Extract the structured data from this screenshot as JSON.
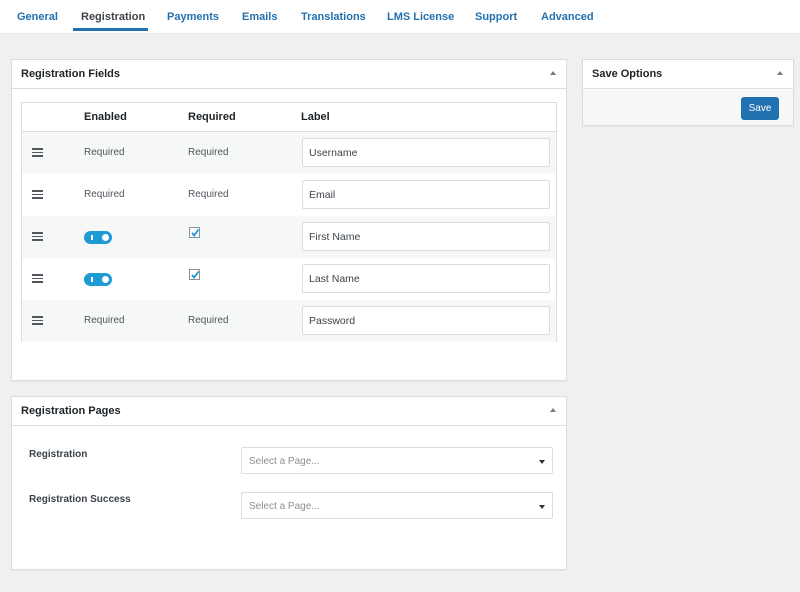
{
  "tabs": [
    {
      "label": "General",
      "active": false
    },
    {
      "label": "Registration",
      "active": true
    },
    {
      "label": "Payments",
      "active": false
    },
    {
      "label": "Emails",
      "active": false
    },
    {
      "label": "Translations",
      "active": false
    },
    {
      "label": "LMS License",
      "active": false
    },
    {
      "label": "Support",
      "active": false
    },
    {
      "label": "Advanced",
      "active": false
    }
  ],
  "registration_fields": {
    "title": "Registration Fields",
    "columns": {
      "enabled": "Enabled",
      "required": "Required",
      "label": "Label"
    },
    "rows": [
      {
        "enabled": "Required",
        "required": "Required",
        "label": "Username",
        "toggle": false
      },
      {
        "enabled": "Required",
        "required": "Required",
        "label": "Email",
        "toggle": false
      },
      {
        "enabled": true,
        "required": true,
        "label": "First Name",
        "toggle": true
      },
      {
        "enabled": true,
        "required": true,
        "label": "Last Name",
        "toggle": true
      },
      {
        "enabled": "Required",
        "required": "Required",
        "label": "Password",
        "toggle": false
      }
    ]
  },
  "save_options": {
    "title": "Save Options",
    "save_label": "Save"
  },
  "registration_pages": {
    "title": "Registration Pages",
    "fields": [
      {
        "label": "Registration",
        "placeholder": "Select a Page..."
      },
      {
        "label": "Registration Success",
        "placeholder": "Select a Page..."
      }
    ]
  },
  "colors": {
    "accent": "#2271b1",
    "toggle_on": "#1e9bd7",
    "background": "#f0f0f1"
  }
}
